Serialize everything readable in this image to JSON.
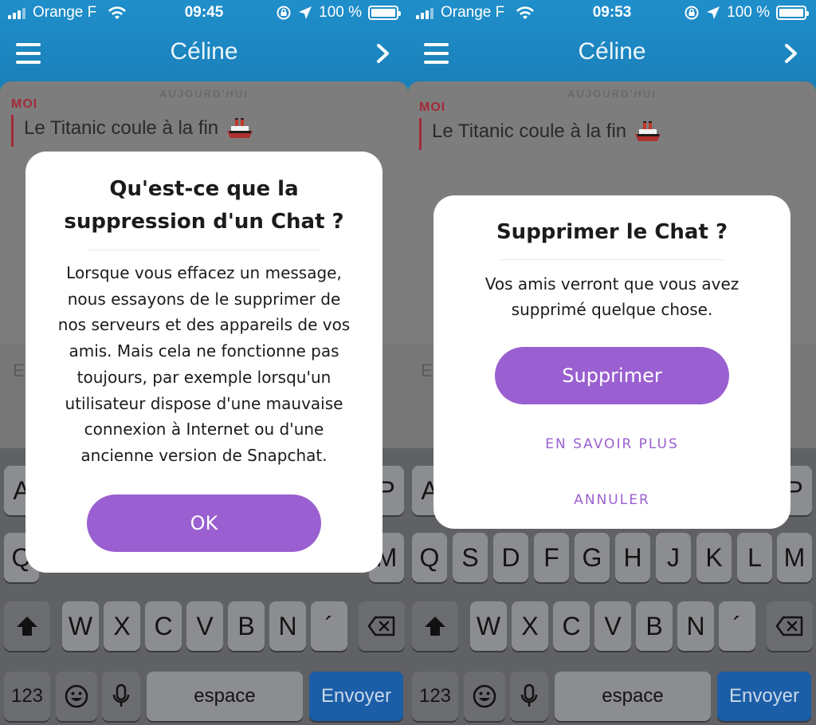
{
  "colors": {
    "header_blue": "#1a7fb8",
    "accent_purple": "#9a5fd0",
    "me_red": "#a42a3a",
    "send_blue": "#1b5da7"
  },
  "screens": [
    {
      "status": {
        "carrier": "Orange F",
        "time": "09:45",
        "battery": "100 %"
      },
      "nav": {
        "title": "Céline"
      },
      "chat": {
        "day": "AUJOURD'HUI",
        "sender": "MOI",
        "message": "Le Titanic coule à la fin"
      },
      "input_partial": "E",
      "dialog": {
        "title_lines": [
          "Qu'est-ce que la",
          "suppression d'un Chat ?"
        ],
        "body_lines": [
          "Lorsque vous effacez un message,",
          "nous essayons de le supprimer de",
          "nos serveurs et des appareils de vos",
          "amis. Mais cela ne fonctionne pas",
          "toujours, par exemple lorsqu'un",
          "utilisateur dispose d'une mauvaise",
          "connexion à Internet ou d'une",
          "ancienne version de Snapchat."
        ],
        "primary_label": "OK"
      },
      "keys_visible": {
        "row1_left": "A",
        "row1_right": "P",
        "row2_left": "Q",
        "row2_right": "M",
        "row3": [
          "W",
          "X",
          "C",
          "V",
          "B",
          "N",
          "´"
        ]
      }
    },
    {
      "status": {
        "carrier": "Orange F",
        "time": "09:53",
        "battery": "100 %"
      },
      "nav": {
        "title": "Céline"
      },
      "chat": {
        "day": "AUJOURD'HUI",
        "sender": "MOI",
        "message": "Le Titanic coule à la fin"
      },
      "input_partial": "E",
      "dialog": {
        "title": "Supprimer le Chat ?",
        "body_lines": [
          "Vos amis verront que vous avez",
          "supprimé quelque chose."
        ],
        "primary_label": "Supprimer",
        "learn_more_label": "EN SAVOIR PLUS",
        "cancel_label": "ANNULER"
      },
      "keys_visible": {
        "row1_left": "A",
        "row1_right": "P",
        "row2": [
          "Q",
          "S",
          "D",
          "F",
          "G",
          "H",
          "J",
          "K",
          "L",
          "M"
        ],
        "row3": [
          "W",
          "X",
          "C",
          "V",
          "B",
          "N",
          "´"
        ]
      }
    }
  ],
  "keyboard": {
    "numbers_label": "123",
    "space_label": "espace",
    "send_label": "Envoyer"
  },
  "icons": [
    "signal-icon",
    "wifi-icon",
    "rotation-lock-icon",
    "location-arrow-icon",
    "battery-icon",
    "menu-icon",
    "chevron-right-icon",
    "ship-emoji-icon",
    "shift-icon",
    "delete-icon",
    "emoji-icon",
    "microphone-icon"
  ]
}
